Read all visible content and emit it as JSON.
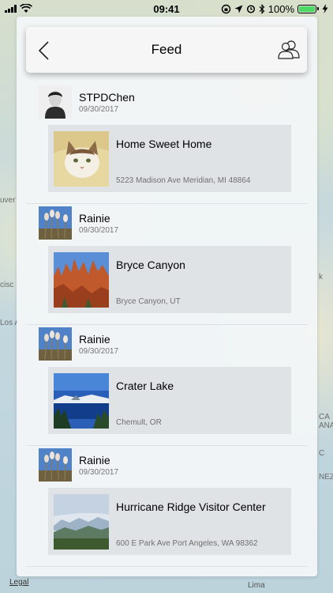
{
  "status_bar": {
    "time": "09:41",
    "battery_percent": "100%"
  },
  "header": {
    "title": "Feed",
    "back_icon": "chevron-left-icon",
    "friends_icon": "friends-icon"
  },
  "map": {
    "legal": "Legal",
    "labels": [
      "uver",
      "cisc",
      "Los A",
      "k",
      "CA",
      "ANA",
      "C",
      "NEZ",
      "Lima"
    ]
  },
  "posts": [
    {
      "user": "STPDChen",
      "date": "09/30/2017",
      "place": {
        "name": "Home Sweet Home",
        "address": "5223 Madison Ave Meridian, MI 48864"
      }
    },
    {
      "user": "Rainie",
      "date": "09/30/2017",
      "place": {
        "name": "Bryce Canyon",
        "address": "Bryce Canyon, UT"
      }
    },
    {
      "user": "Rainie",
      "date": "09/30/2017",
      "place": {
        "name": "Crater Lake",
        "address": "Chemult, OR"
      }
    },
    {
      "user": "Rainie",
      "date": "09/30/2017",
      "place": {
        "name": "Hurricane Ridge Visitor Center",
        "address": "600 E Park Ave Port Angeles, WA 98362"
      }
    }
  ]
}
